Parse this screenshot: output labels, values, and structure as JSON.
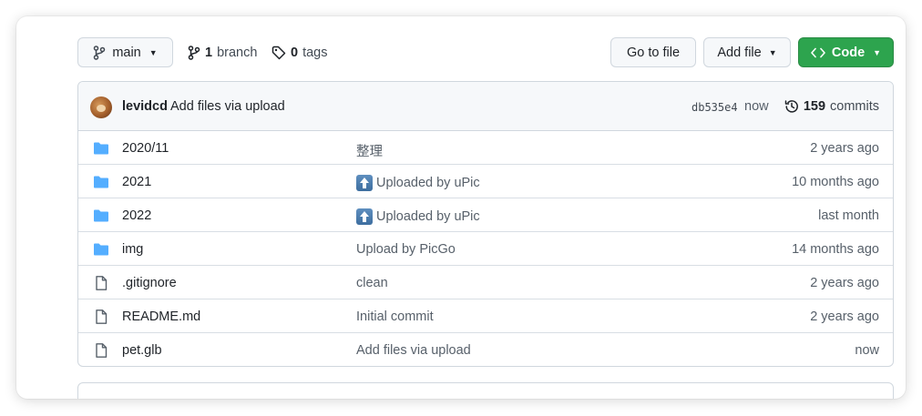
{
  "toolbar": {
    "branch_label": "main",
    "branch_count": "1",
    "branch_word": "branch",
    "tag_count": "0",
    "tag_word": "tags",
    "goto_label": "Go to file",
    "addfile_label": "Add file",
    "code_label": "Code"
  },
  "commit": {
    "author": "levidcd",
    "message": "Add files via upload",
    "sha": "db535e4",
    "time": "now",
    "count": "159",
    "count_word": "commits"
  },
  "files": [
    {
      "type": "dir",
      "name": "2020/11",
      "message": "整理",
      "message_icon": "",
      "age": "2 years ago"
    },
    {
      "type": "dir",
      "name": "2021",
      "message": "Uploaded by uPic",
      "message_icon": "upload-arrow-icon",
      "age": "10 months ago"
    },
    {
      "type": "dir",
      "name": "2022",
      "message": "Uploaded by uPic",
      "message_icon": "upload-arrow-icon",
      "age": "last month"
    },
    {
      "type": "dir",
      "name": "img",
      "message": "Upload by PicGo",
      "message_icon": "",
      "age": "14 months ago"
    },
    {
      "type": "file",
      "name": ".gitignore",
      "message": "clean",
      "message_icon": "",
      "age": "2 years ago"
    },
    {
      "type": "file",
      "name": "README.md",
      "message": "Initial commit",
      "message_icon": "",
      "age": "2 years ago"
    },
    {
      "type": "file",
      "name": "pet.glb",
      "message": "Add files via upload",
      "message_icon": "",
      "age": "now"
    }
  ],
  "colors": {
    "folder": "#54aeff",
    "code_button": "#2da44e",
    "border": "#d0d7de"
  }
}
